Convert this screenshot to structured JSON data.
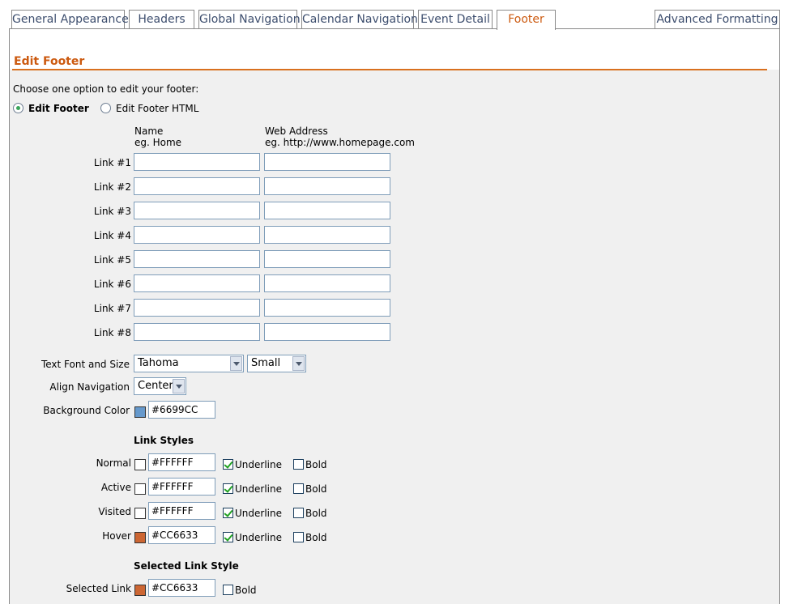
{
  "tabs": [
    {
      "label": "General Appearance"
    },
    {
      "label": "Headers"
    },
    {
      "label": "Global Navigation"
    },
    {
      "label": "Calendar Navigation"
    },
    {
      "label": "Event Detail"
    },
    {
      "label": "Footer"
    },
    {
      "label": "Advanced Formatting"
    }
  ],
  "active_tab": "Footer",
  "panel": {
    "title": "Edit Footer",
    "instruction": "Choose one option to edit your footer:",
    "option_edit_footer": "Edit Footer",
    "option_edit_html": "Edit Footer HTML",
    "name_header": "Name",
    "name_example": "eg. Home",
    "web_header": "Web Address",
    "web_example": "eg. http://www.homepage.com"
  },
  "links": [
    {
      "label": "Link #1",
      "name": "",
      "url": ""
    },
    {
      "label": "Link #2",
      "name": "",
      "url": ""
    },
    {
      "label": "Link #3",
      "name": "",
      "url": ""
    },
    {
      "label": "Link #4",
      "name": "",
      "url": ""
    },
    {
      "label": "Link #5",
      "name": "",
      "url": ""
    },
    {
      "label": "Link #6",
      "name": "",
      "url": ""
    },
    {
      "label": "Link #7",
      "name": "",
      "url": ""
    },
    {
      "label": "Link #8",
      "name": "",
      "url": ""
    }
  ],
  "settings": {
    "font_label": "Text Font and Size",
    "font_value": "Tahoma",
    "size_value": "Small",
    "align_label": "Align Navigation",
    "align_value": "Center",
    "bg_label": "Background Color",
    "bg_value": "#6699CC",
    "bg_swatch": "#6699CC"
  },
  "link_styles": {
    "heading": "Link Styles",
    "underline_label": "Underline",
    "bold_label": "Bold",
    "rows": [
      {
        "label": "Normal",
        "color": "#FFFFFF",
        "swatch": "#FFFFFF",
        "underline": true,
        "bold": false
      },
      {
        "label": "Active",
        "color": "#FFFFFF",
        "swatch": "#FFFFFF",
        "underline": true,
        "bold": false
      },
      {
        "label": "Visited",
        "color": "#FFFFFF",
        "swatch": "#FFFFFF",
        "underline": true,
        "bold": false
      },
      {
        "label": "Hover",
        "color": "#CC6633",
        "swatch": "#CC6633",
        "underline": true,
        "bold": false
      }
    ]
  },
  "selected_link_style": {
    "heading": "Selected Link Style",
    "label": "Selected Link",
    "color": "#CC6633",
    "swatch": "#CC6633",
    "bold_label": "Bold",
    "bold": false
  },
  "colors": {
    "accent": "#CC5A10",
    "tab_text": "#3D4E6E",
    "panel_bg": "#F0F0F0"
  }
}
